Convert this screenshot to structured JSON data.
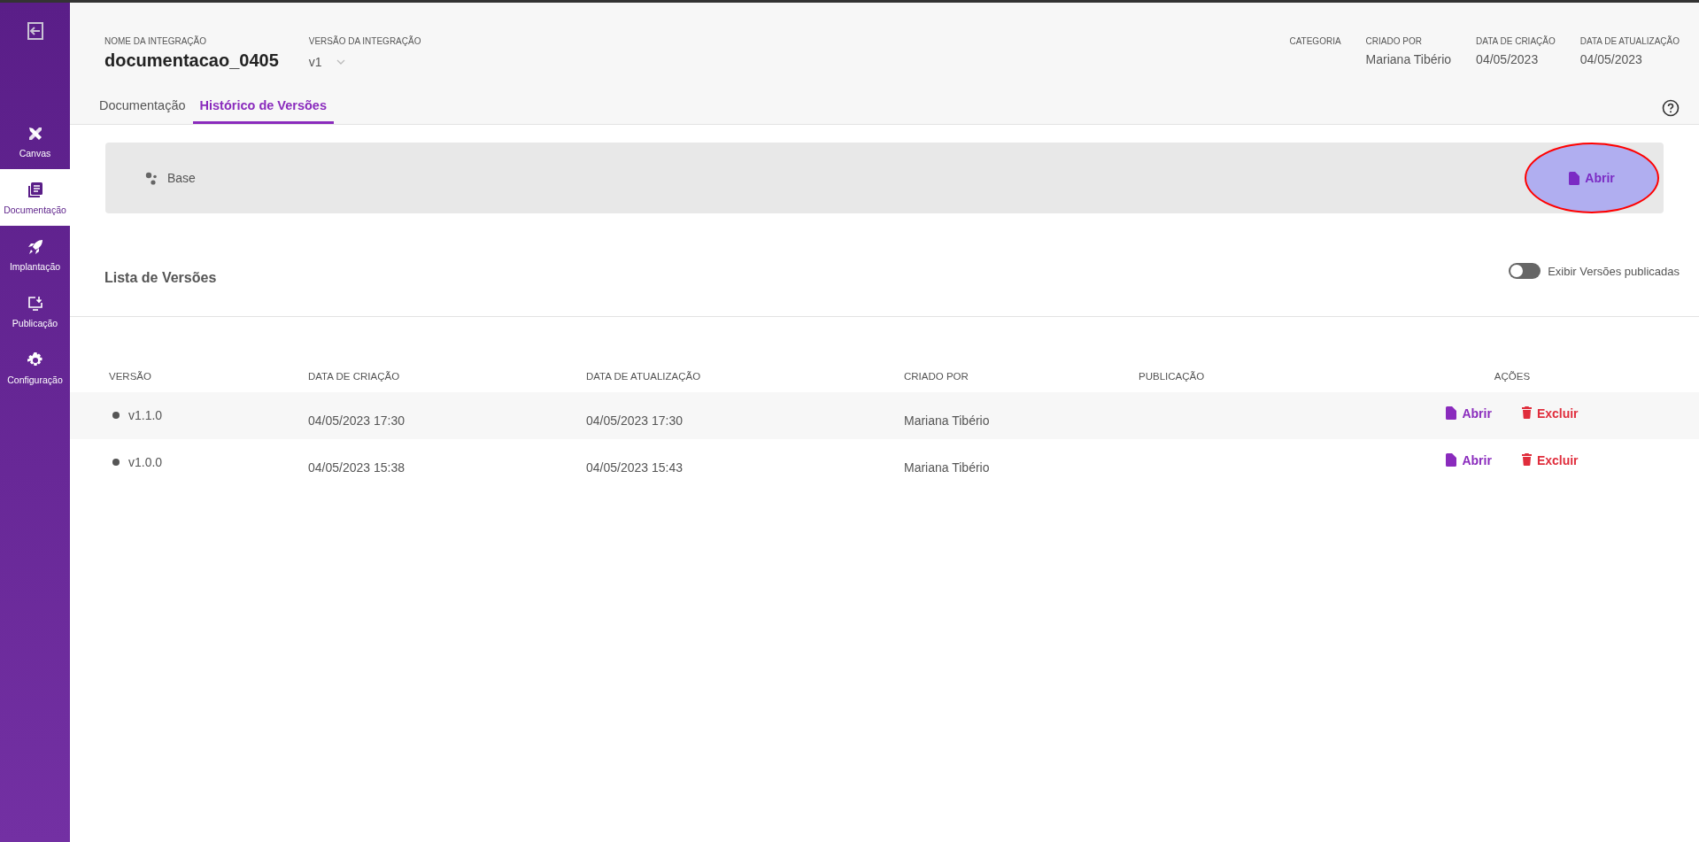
{
  "sidebar": {
    "items": [
      {
        "label": "Canvas",
        "selected": false
      },
      {
        "label": "Documentação",
        "selected": true
      },
      {
        "label": "Implantação",
        "selected": false
      },
      {
        "label": "Publicação",
        "selected": false
      },
      {
        "label": "Configuração",
        "selected": false
      }
    ]
  },
  "header": {
    "fields": [
      {
        "label": "NOME DA INTEGRAÇÃO",
        "value": "documentacao_0405",
        "kind": "title"
      },
      {
        "label": "VERSÃO DA INTEGRAÇÃO",
        "value": "v1",
        "kind": "select"
      }
    ],
    "meta": [
      {
        "label": "CATEGORIA"
      },
      {
        "label": "CRIADO POR",
        "value": "Mariana Tibério"
      },
      {
        "label": "DATA DE CRIAÇÃO",
        "value": "04/05/2023"
      },
      {
        "label": "DATA DE ATUALIZAÇÃO",
        "value": "04/05/2023"
      }
    ],
    "tabs": [
      {
        "label": "Documentação",
        "selected": false
      },
      {
        "label": "Histórico de Versões",
        "selected": true
      }
    ]
  },
  "base": {
    "label": "Base",
    "button": "Abrir",
    "highlighted": true
  },
  "versions": {
    "title": "Lista de Versões",
    "toggle": {
      "label": "Exibir Versões publicadas",
      "on": false
    },
    "columns": [
      "VERSÃO",
      "DATA DE CRIAÇÃO",
      "DATA DE ATUALIZAÇÃO",
      "CRIADO POR",
      "PUBLICAÇÃO",
      "AÇÕES"
    ],
    "rows": [
      {
        "version": "v1.1.0",
        "created": "04/05/2023 17:30",
        "updated": "04/05/2023 17:30",
        "author": "Mariana Tibério",
        "actions": [
          "Abrir",
          "Excluir"
        ]
      },
      {
        "version": "v1.0.0",
        "created": "04/05/2023 15:38",
        "updated": "04/05/2023 15:43",
        "author": "Mariana Tibério",
        "actions": [
          "Abrir",
          "Excluir"
        ]
      }
    ]
  }
}
